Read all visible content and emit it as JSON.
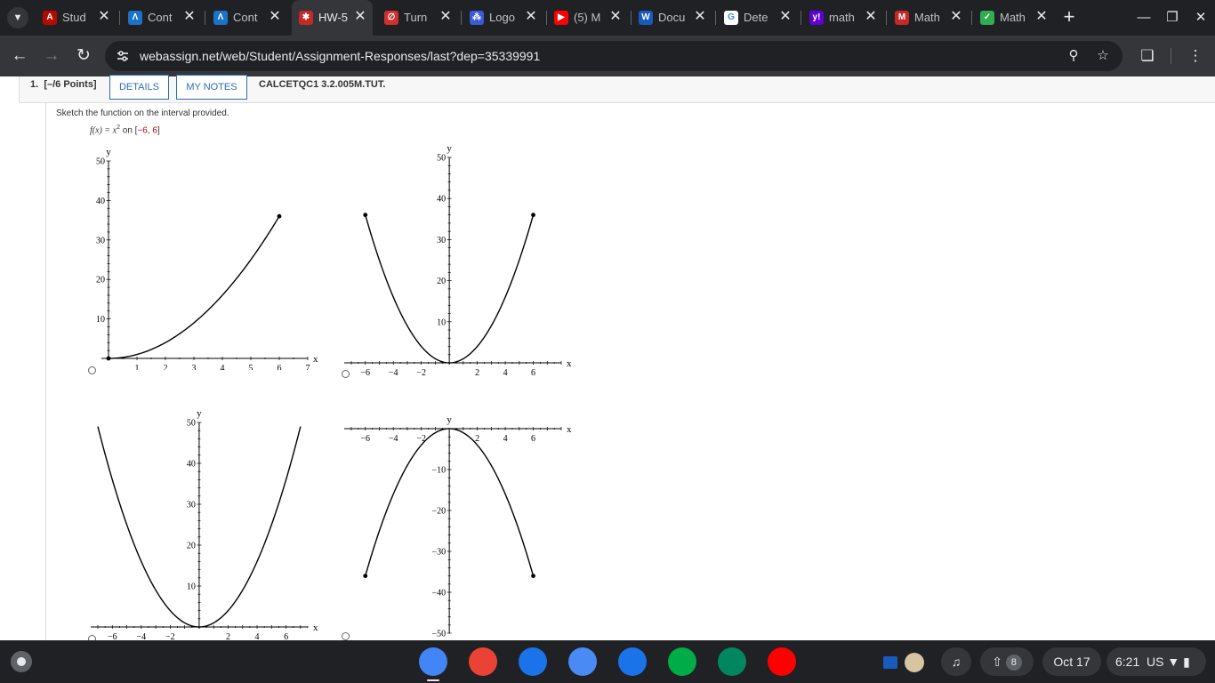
{
  "browser": {
    "tabs": [
      {
        "title": "Stud",
        "favicon": "acrobat-icon",
        "color": "#b30b00",
        "glyph": "A"
      },
      {
        "title": "Cont",
        "favicon": "aleks-icon",
        "color": "#1a73c8",
        "glyph": "Λ"
      },
      {
        "title": "Cont",
        "favicon": "aleks-icon",
        "color": "#1a73c8",
        "glyph": "Λ"
      },
      {
        "title": "HW-5",
        "favicon": "webassign-icon",
        "color": "#c62828",
        "glyph": "✱",
        "active": true
      },
      {
        "title": "Turn",
        "favicon": "turnitin-icon",
        "color": "#d32f2f",
        "glyph": "∅"
      },
      {
        "title": "Logo",
        "favicon": "loading-spinner-icon",
        "color": "#3a5ad8",
        "glyph": "⁂"
      },
      {
        "title": "(5) M",
        "favicon": "youtube-icon",
        "color": "#ff0000",
        "glyph": "▶"
      },
      {
        "title": "Docu",
        "favicon": "word-icon",
        "color": "#185abd",
        "glyph": "W"
      },
      {
        "title": "Dete",
        "favicon": "google-icon",
        "color": "#ffffff",
        "glyph": "G"
      },
      {
        "title": "math",
        "favicon": "yahoo-icon",
        "color": "#6001d2",
        "glyph": "y!"
      },
      {
        "title": "Math",
        "favicon": "mathway-icon",
        "color": "#c62828",
        "glyph": "M"
      },
      {
        "title": "Math",
        "favicon": "shield-check-icon",
        "color": "#2eae4e",
        "glyph": "✓"
      }
    ],
    "close_glyph": "✕",
    "new_tab_glyph": "+",
    "url": "webassign.net/web/Student/Assignment-Responses/last?dep=35339991"
  },
  "question": {
    "number": "1.",
    "points": "[–/6 Points]",
    "details_label": "DETAILS",
    "notes_label": "MY NOTES",
    "code": "CALCETQC1 3.2.005M.TUT.",
    "prompt": "Sketch the function on the interval provided.",
    "function": {
      "lhs": "f(x) = x",
      "exp": "2",
      "on": "on",
      "open": "[",
      "a": "−6",
      "comma": ", ",
      "b": "6",
      "close": "]"
    }
  },
  "choices": [
    {
      "id": "A",
      "chart_data": {
        "type": "line",
        "function": "x^2",
        "x_range": [
          0,
          6
        ],
        "xlim": [
          0,
          7
        ],
        "ylim": [
          0,
          50
        ],
        "x_ticks": [
          "1",
          "2",
          "3",
          "4",
          "5",
          "6",
          "7"
        ],
        "y_ticks": [
          "10",
          "20",
          "30",
          "40",
          "50"
        ],
        "xlabel": "x",
        "ylabel": "y",
        "endpoints": [
          [
            0,
            0
          ],
          [
            6,
            36
          ]
        ]
      }
    },
    {
      "id": "B",
      "chart_data": {
        "type": "line",
        "function": "x^2",
        "x_range": [
          -6,
          6
        ],
        "xlim": [
          -7,
          8
        ],
        "ylim": [
          0,
          50
        ],
        "x_ticks": [
          "−6",
          "−4",
          "−2",
          "2",
          "4",
          "6"
        ],
        "y_ticks": [
          "10",
          "20",
          "30",
          "40",
          "50"
        ],
        "xlabel": "x",
        "ylabel": "y",
        "endpoints": [
          [
            -6,
            36
          ],
          [
            6,
            36
          ]
        ]
      }
    },
    {
      "id": "C",
      "chart_data": {
        "type": "line",
        "function": "x^2",
        "x_range": [
          -7,
          7
        ],
        "xlim": [
          -7,
          7.5
        ],
        "ylim": [
          0,
          50
        ],
        "x_ticks": [
          "−6",
          "−4",
          "−2",
          "2",
          "4",
          "6"
        ],
        "y_ticks": [
          "10",
          "20",
          "30",
          "40",
          "50"
        ],
        "xlabel": "x",
        "ylabel": "y",
        "endpoints": []
      }
    },
    {
      "id": "D",
      "chart_data": {
        "type": "line",
        "function": "-x^2",
        "x_range": [
          -6,
          6
        ],
        "xlim": [
          -7,
          8
        ],
        "ylim": [
          -50,
          0
        ],
        "x_ticks": [
          "−6",
          "−4",
          "−2",
          "2",
          "4",
          "6"
        ],
        "y_ticks": [
          "−10",
          "−20",
          "−30",
          "−40",
          "−50"
        ],
        "xlabel": "x",
        "ylabel": "y",
        "endpoints": [
          [
            -6,
            -36
          ],
          [
            6,
            -36
          ]
        ]
      }
    }
  ],
  "shelf": {
    "apps": [
      {
        "name": "chrome-icon",
        "color": "#4285f4"
      },
      {
        "name": "gmail-icon",
        "color": "#ea4335"
      },
      {
        "name": "calendar-icon",
        "color": "#1a73e8"
      },
      {
        "name": "files-icon",
        "color": "#4a8af4"
      },
      {
        "name": "messages-icon",
        "color": "#1a73e8"
      },
      {
        "name": "meet-icon",
        "color": "#00ac47"
      },
      {
        "name": "play-store-icon",
        "color": "#01875f"
      },
      {
        "name": "youtube-icon",
        "color": "#ff0000"
      }
    ],
    "notification_count": "8",
    "date": "Oct 17",
    "time": "6:21",
    "locale": "US"
  }
}
